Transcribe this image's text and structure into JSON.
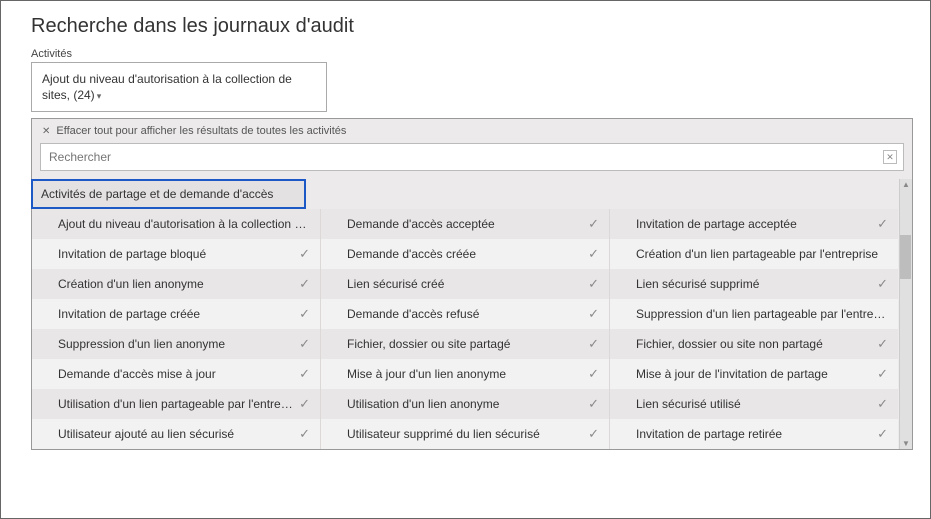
{
  "pageTitle": "Recherche dans les journaux d'audit",
  "activitiesLabel": "Activités",
  "selectedActivitiesText": "Ajout du niveau d'autorisation à la collection de sites, (24)",
  "clearAllText": "Effacer tout pour afficher les résultats de toutes les activités",
  "searchPlaceholder": "Rechercher",
  "categoryHeader": "Activités de partage et de demande d'accès",
  "rows": [
    [
      {
        "label": "Ajout du niveau d'autorisation à la collection de sites",
        "checked": false
      },
      {
        "label": "Demande d'accès acceptée",
        "checked": true
      },
      {
        "label": "Invitation de partage acceptée",
        "checked": true
      }
    ],
    [
      {
        "label": "Invitation de partage bloqué",
        "checked": true
      },
      {
        "label": "Demande d'accès créée",
        "checked": true
      },
      {
        "label": "Création d'un lien partageable par l'entreprise",
        "checked": false
      }
    ],
    [
      {
        "label": "Création d'un lien anonyme",
        "checked": true
      },
      {
        "label": "Lien sécurisé créé",
        "checked": true
      },
      {
        "label": "Lien sécurisé supprimé",
        "checked": true
      }
    ],
    [
      {
        "label": "Invitation de partage créée",
        "checked": true
      },
      {
        "label": "Demande d'accès refusé",
        "checked": true
      },
      {
        "label": "Suppression d'un lien partageable par l'entreprise",
        "checked": false
      }
    ],
    [
      {
        "label": "Suppression d'un lien anonyme",
        "checked": true
      },
      {
        "label": "Fichier, dossier ou site partagé",
        "checked": true
      },
      {
        "label": "Fichier, dossier ou site non partagé",
        "checked": true
      }
    ],
    [
      {
        "label": "Demande d'accès mise à jour",
        "checked": true
      },
      {
        "label": "Mise à jour d'un lien anonyme",
        "checked": true
      },
      {
        "label": "Mise à jour de l'invitation de partage",
        "checked": true
      }
    ],
    [
      {
        "label": "Utilisation d'un lien partageable par l'entreprise",
        "checked": true
      },
      {
        "label": "Utilisation d'un lien anonyme",
        "checked": true
      },
      {
        "label": "Lien sécurisé utilisé",
        "checked": true
      }
    ],
    [
      {
        "label": "Utilisateur ajouté au lien sécurisé",
        "checked": true
      },
      {
        "label": "Utilisateur supprimé du lien sécurisé",
        "checked": true
      },
      {
        "label": "Invitation de partage retirée",
        "checked": true
      }
    ]
  ]
}
